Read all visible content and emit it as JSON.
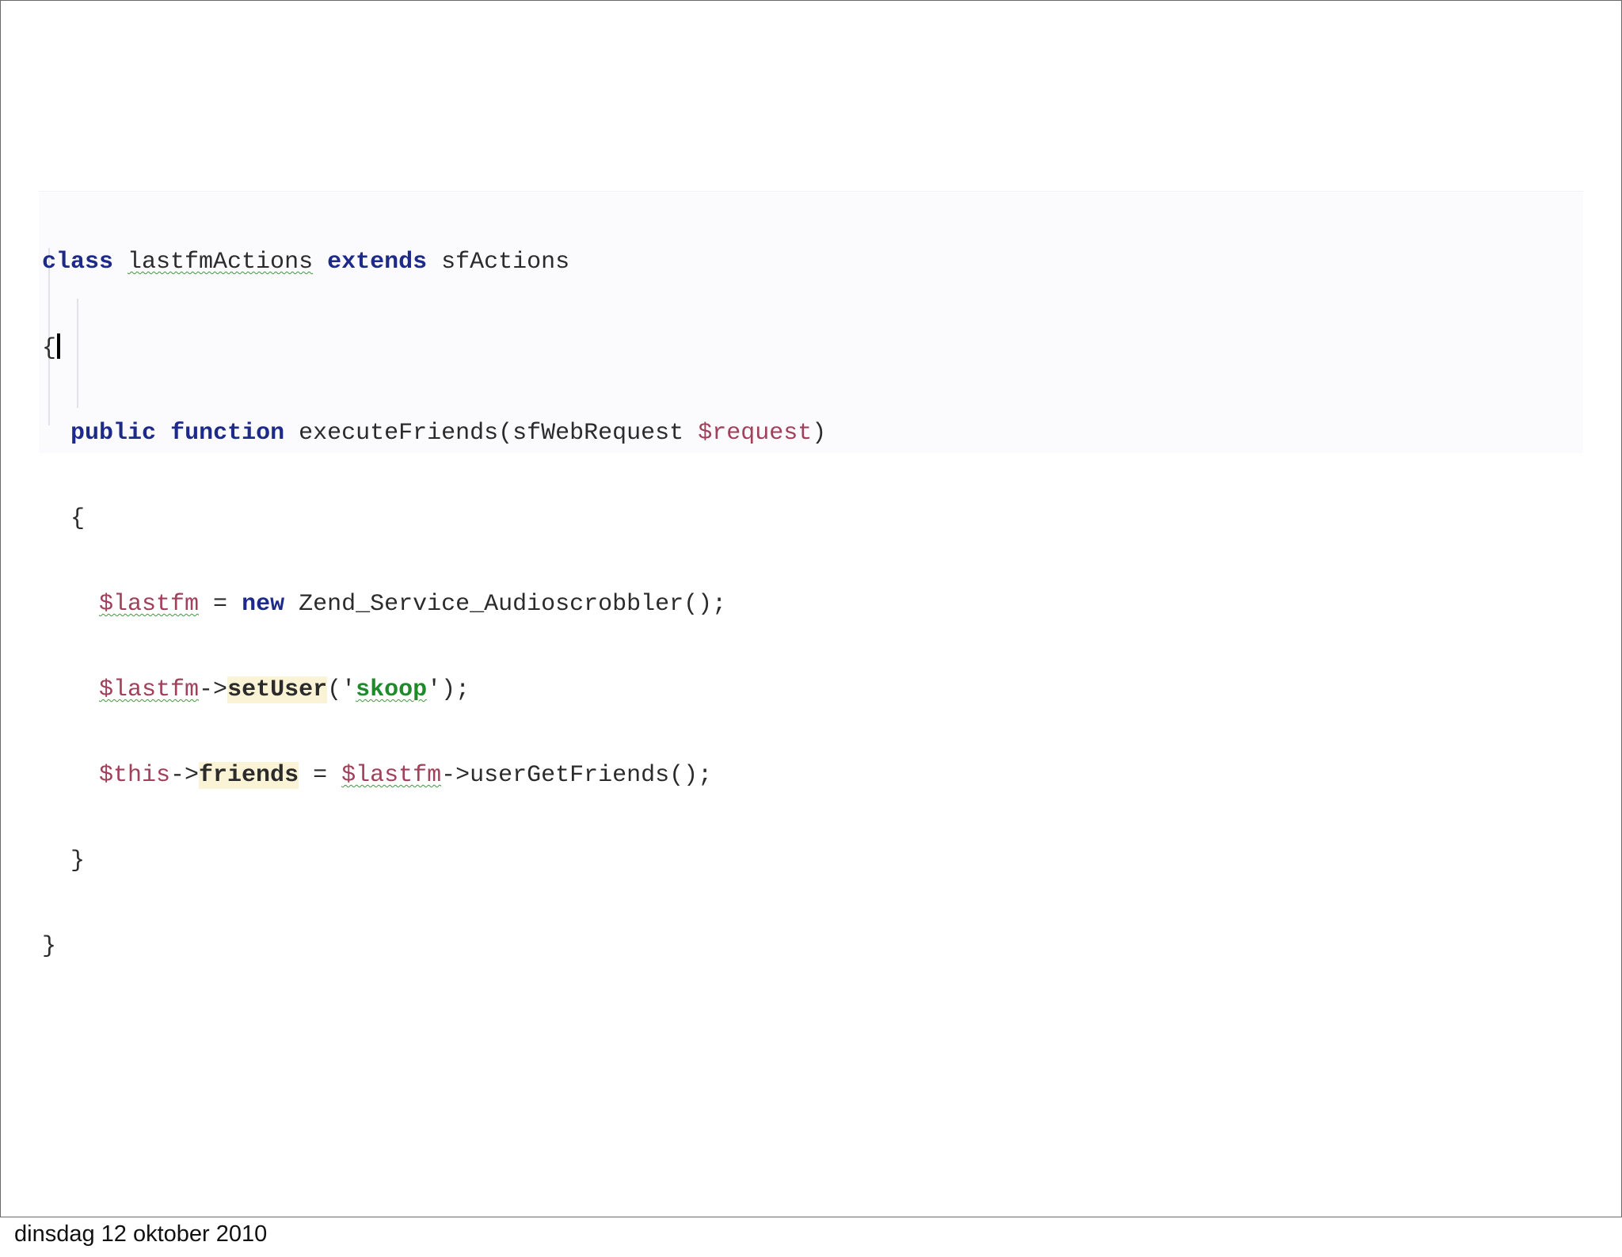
{
  "code": {
    "line1": {
      "kw_class": "class",
      "class_name": "lastfmActions",
      "kw_extends": "extends",
      "parent": "sfActions"
    },
    "line2": {
      "brace": "{"
    },
    "line3": {
      "kw_public": "public",
      "kw_function": "function",
      "fn_name": "executeFriends(sfWebRequest ",
      "param": "$request",
      "close": ")"
    },
    "line4": {
      "brace": "{"
    },
    "line5": {
      "var": "$lastfm",
      "op": " = ",
      "kw_new": "new",
      "rest": " Zend_Service_Audioscrobbler();"
    },
    "line6": {
      "var": "$lastfm",
      "arrow": "->",
      "method": "setUser",
      "open": "('",
      "string": "skoop",
      "close": "');"
    },
    "line7": {
      "var": "$this",
      "arrow": "->",
      "prop": "friends",
      "op": " = ",
      "var2": "$lastfm",
      "rest": "->userGetFriends();"
    },
    "line8": {
      "brace": "}"
    },
    "line9": {
      "brace": "}"
    }
  },
  "footer": {
    "date": "dinsdag 12 oktober 2010"
  }
}
